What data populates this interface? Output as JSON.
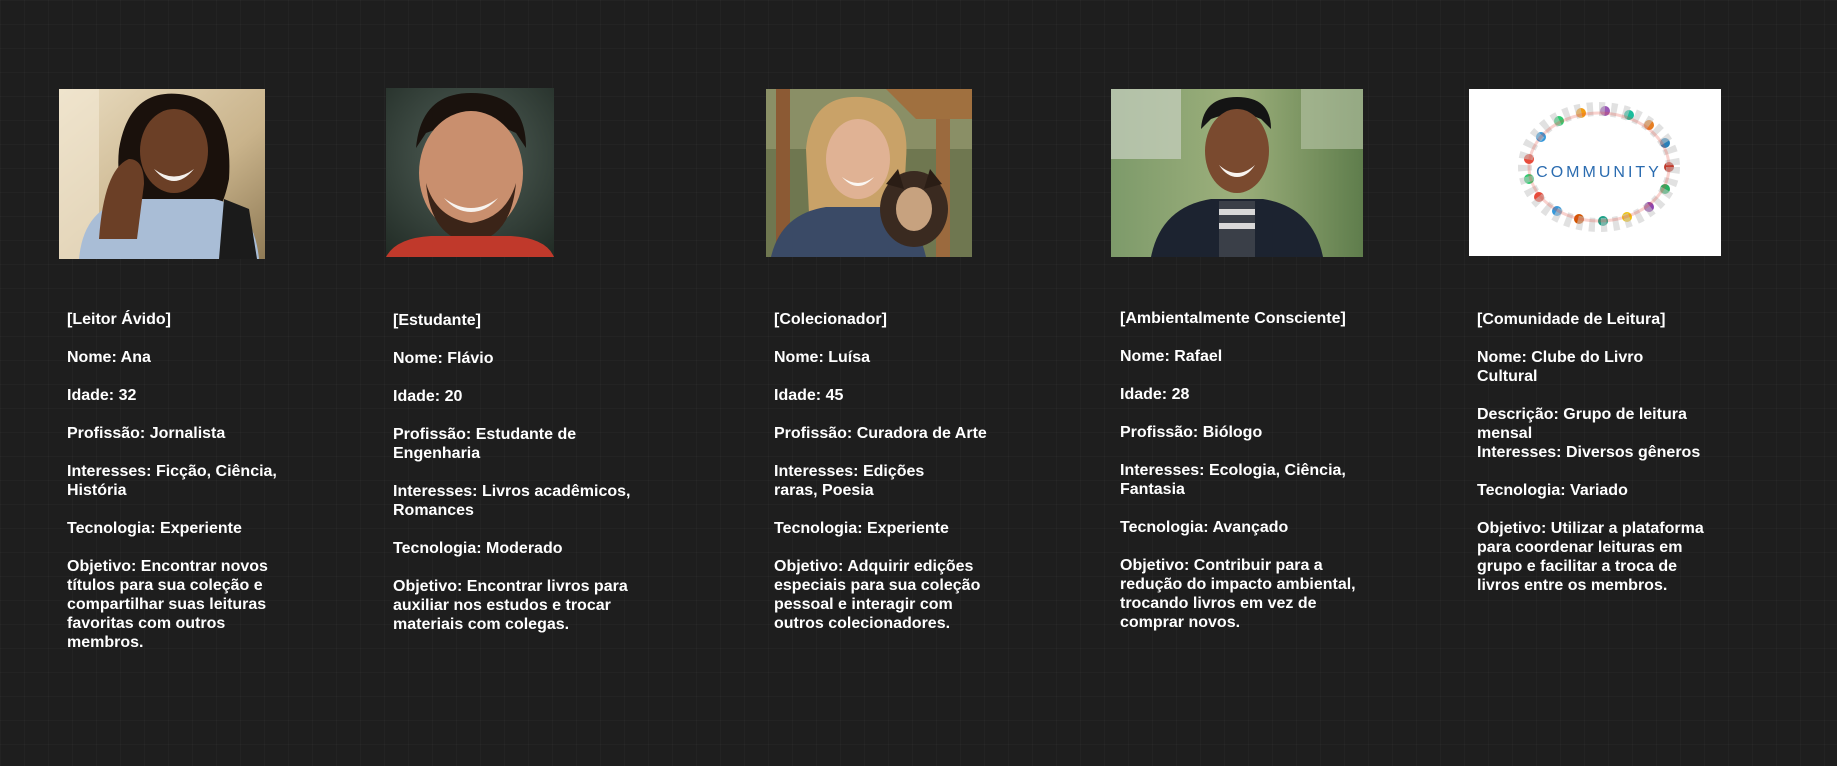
{
  "personas": [
    {
      "role": "[Leitor Ávido]",
      "name": "Nome: Ana",
      "age": "Idade: 32",
      "profession": "Profissão: Jornalista",
      "interests": "Interesses: Ficção, Ciência, História",
      "technology": "Tecnologia: Experiente",
      "goal": "Objetivo: Encontrar novos títulos para sua coleção e compartilhar suas leituras favoritas com outros membros."
    },
    {
      "role": "[Estudante]",
      "name": "Nome: Flávio",
      "age": "Idade: 20",
      "profession": "Profissão: Estudante de Engenharia",
      "interests": "Interesses: Livros acadêmicos, Romances",
      "technology": "Tecnologia: Moderado",
      "goal": "Objetivo: Encontrar livros para auxiliar nos estudos e trocar materiais com colegas."
    },
    {
      "role": "[Colecionador]",
      "name": "Nome: Luísa",
      "age": "Idade: 45",
      "profession": "Profissão: Curadora de Arte",
      "interests": "Interesses: Edições raras, Poesia",
      "technology": "Tecnologia: Experiente",
      "goal": "Objetivo: Adquirir edições especiais para sua coleção pessoal e interagir com outros colecionadores."
    },
    {
      "role": "[Ambientalmente Consciente]",
      "name": "Nome: Rafael",
      "age": "Idade: 28",
      "profession": "Profissão: Biólogo",
      "interests": "Interesses: Ecologia, Ciência, Fantasia",
      "technology": "Tecnologia: Avançado",
      "goal": "Objetivo: Contribuir para a redução do impacto ambiental, trocando livros em vez de comprar novos."
    },
    {
      "role": "[Comunidade de Leitura]",
      "name": "Nome: Clube do Livro Cultural",
      "description": "Descrição: Grupo de leitura mensal",
      "interests": "Interesses: Diversos gêneros",
      "technology": "Tecnologia: Variado",
      "goal": "Objetivo: Utilizar a plataforma para coordenar leituras em grupo e facilitar a troca de livros entre os membros.",
      "image_word": "COMMUNITY"
    }
  ],
  "colors": {
    "background": "#1e1e1e",
    "text": "#ffffff"
  }
}
